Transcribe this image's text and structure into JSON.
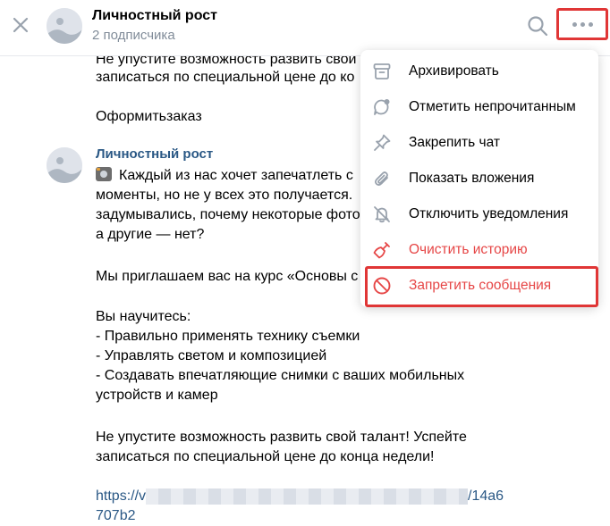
{
  "header": {
    "title": "Личностный рост",
    "subtitle": "2 подписчика"
  },
  "messages": {
    "prev_line1": "Не упустите возможность развить свой",
    "prev_line2": "записаться по специальной цене до ко",
    "order_text": "Оформитьзаказ",
    "author": "Личностный рост",
    "lines": [
      "Каждый из нас хочет запечатлеть с",
      "моменты, но не у всех это получается.",
      "задумывались, почему некоторые фото",
      "а другие — нет?",
      "Мы приглашаем вас на курс «Основы с",
      "Вы научитесь:",
      "- Правильно применять технику съемки",
      "- Управлять светом и композицией",
      "- Создавать впечатляющие снимки с ваших мобильных",
      "устройств и камер",
      "Не упустите возможность развить свой талант! Успейте",
      "записаться по специальной цене до конца недели!"
    ],
    "link_start": "https://v",
    "link_end": "/14a6",
    "link_line2": "707b2"
  },
  "menu": {
    "items": [
      {
        "label": "Архивировать",
        "icon": "archive-icon"
      },
      {
        "label": "Отметить непрочитанным",
        "icon": "unread-icon"
      },
      {
        "label": "Закрепить чат",
        "icon": "pin-icon"
      },
      {
        "label": "Показать вложения",
        "icon": "paperclip-icon"
      },
      {
        "label": "Отключить уведомления",
        "icon": "bell-off-icon"
      },
      {
        "label": "Очистить историю",
        "icon": "broom-icon"
      },
      {
        "label": "Запретить сообщения",
        "icon": "block-icon"
      }
    ]
  },
  "colors": {
    "danger": "#e64646",
    "icon": "#99a2ad",
    "link": "#2a5885",
    "highlight": "#e03636"
  }
}
